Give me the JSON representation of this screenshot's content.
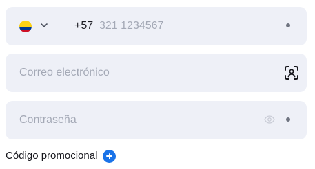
{
  "phone": {
    "country_flag": "colombia-flag-icon",
    "dropdown_icon": "chevron-down-icon",
    "prefix": "+57",
    "placeholder": "321 1234567",
    "value": ""
  },
  "email": {
    "placeholder": "Correo electrónico",
    "value": "",
    "icon": "contact-scan-icon"
  },
  "password": {
    "placeholder": "Contraseña",
    "value": "",
    "icon": "eye-icon"
  },
  "promo": {
    "label": "Código promocional",
    "icon": "plus-circle-icon"
  },
  "colors": {
    "field_background": "#eef0f7",
    "placeholder": "#a4a9b6",
    "accent": "#1a73e8",
    "flag_yellow": "#fcd116",
    "flag_blue": "#003893",
    "flag_red": "#ce1126"
  }
}
